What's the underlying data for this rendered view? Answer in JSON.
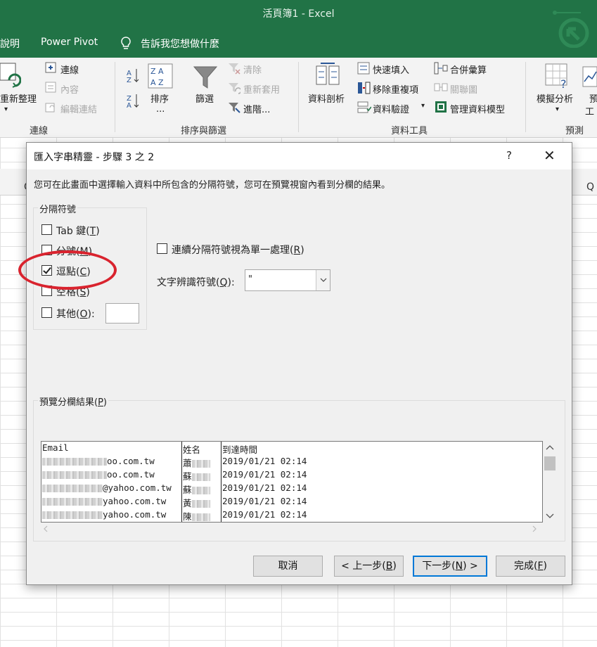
{
  "window": {
    "title": "活頁簿1  -  Excel"
  },
  "menu": {
    "items": [
      "說明",
      "Power Pivot"
    ],
    "tell_me": "告訴我您想做什麼"
  },
  "ribbon": {
    "connections": {
      "refresh_all": "重新整理",
      "connections": "連線",
      "properties": "內容",
      "edit_links": "編輯連結",
      "group": "連線"
    },
    "sort_filter": {
      "sort": "排序",
      "sort_dots": "...",
      "filter": "篩選",
      "clear": "清除",
      "reapply": "重新套用",
      "advanced": "進階...",
      "group": "排序與篩選"
    },
    "data_tools": {
      "text_to_columns": "資料剖析",
      "flash_fill": "快速填入",
      "remove_duplicates": "移除重複項",
      "data_validation": "資料驗證",
      "consolidate": "合併彙算",
      "relationships": "關聯圖",
      "manage_model": "管理資料模型",
      "group": "資料工具"
    },
    "forecast": {
      "what_if": "模擬分析",
      "forecast_sheet_a": "預",
      "forecast_sheet_b": "工",
      "group": "預測"
    }
  },
  "sheet": {
    "col_left": "C",
    "col_right": "Q"
  },
  "dialog": {
    "title": "匯入字串精靈 - 步驟 3 之 2",
    "help": "?",
    "close": "✕",
    "description": "您可在此畫面中選擇輸入資料中所包含的分隔符號，您可在預覽視窗內看到分欄的結果。",
    "delimiters": {
      "legend": "分隔符號",
      "tab": {
        "label": "Tab 鍵(",
        "key": "T",
        "end": ")",
        "checked": false
      },
      "semicolon": {
        "label": "分號(",
        "key": "M",
        "end": ")",
        "checked": false
      },
      "comma": {
        "label": "逗點(",
        "key": "C",
        "end": ")",
        "checked": true
      },
      "space": {
        "label": "空格(",
        "key": "S",
        "end": ")",
        "checked": false
      },
      "other": {
        "label": "其他(",
        "key": "O",
        "end": "):",
        "checked": false
      }
    },
    "consecutive": {
      "label": "連續分隔符號視為單一處理(",
      "key": "R",
      "end": ")",
      "checked": false
    },
    "qualifier": {
      "label": "文字辨識符號(",
      "key": "Q",
      "end": "):",
      "value": "\""
    },
    "preview": {
      "legend_label": "預覽分欄結果(",
      "legend_key": "P",
      "legend_end": ")",
      "columns": [
        "Email",
        "姓名",
        "到達時間"
      ],
      "rows": [
        {
          "email": "oo.com.tw",
          "name": "蕭",
          "time": "2019/01/21 02:14"
        },
        {
          "email": "oo.com.tw",
          "name": "蘇",
          "time": "2019/01/21 02:14"
        },
        {
          "email": "@yahoo.com.tw",
          "name": "蘇",
          "time": "2019/01/21 02:14"
        },
        {
          "email": "yahoo.com.tw",
          "name": "黃",
          "time": "2019/01/21 02:14"
        },
        {
          "email": "yahoo.com.tw",
          "name": "陳",
          "time": "2019/01/21 02:14"
        }
      ]
    },
    "buttons": {
      "cancel": "取消",
      "back": {
        "label": "< 上一步(",
        "key": "B",
        "end": ")"
      },
      "next": {
        "label": "下一步(",
        "key": "N",
        "end": ") >"
      },
      "finish": {
        "label": "完成(",
        "key": "F",
        "end": ")"
      }
    }
  },
  "colors": {
    "excel_green": "#217346",
    "annotation": "#d9232e",
    "focus": "#0078d7"
  }
}
